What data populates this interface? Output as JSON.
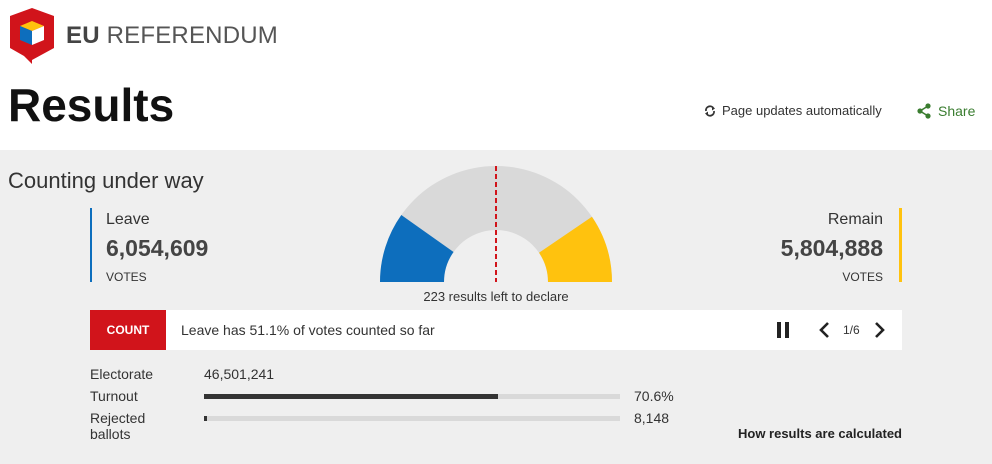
{
  "header": {
    "brand_bold": "EU",
    "brand_rest": "REFERENDUM",
    "page_title": "Results",
    "updates_label": "Page updates automatically",
    "share_label": "Share"
  },
  "status": "Counting under way",
  "leave": {
    "name": "Leave",
    "votes": "6,054,609",
    "unit": "VOTES",
    "color": "#0d6ebd"
  },
  "remain": {
    "name": "Remain",
    "votes": "5,804,888",
    "unit": "VOTES",
    "color": "#ffc20e"
  },
  "gauge": {
    "leave_share": 0.196,
    "remain_share": 0.19,
    "midline_color": "#d1141b"
  },
  "left_to_declare": "223 results left to declare",
  "ticker": {
    "label": "COUNT",
    "text": "Leave has 51.1% of votes counted so far",
    "page": "1/6"
  },
  "stats": {
    "electorate_label": "Electorate",
    "electorate_value": "46,501,241",
    "turnout_label": "Turnout",
    "turnout_pct": "70.6%",
    "turnout_fraction": 0.706,
    "rejected_label_1": "Rejected",
    "rejected_label_2": "ballots",
    "rejected_value": "8,148",
    "rejected_fraction": 0.007
  },
  "how_link": "How results are calculated",
  "colors": {
    "accent_red": "#d1141b",
    "share_green": "#3a7d30"
  }
}
